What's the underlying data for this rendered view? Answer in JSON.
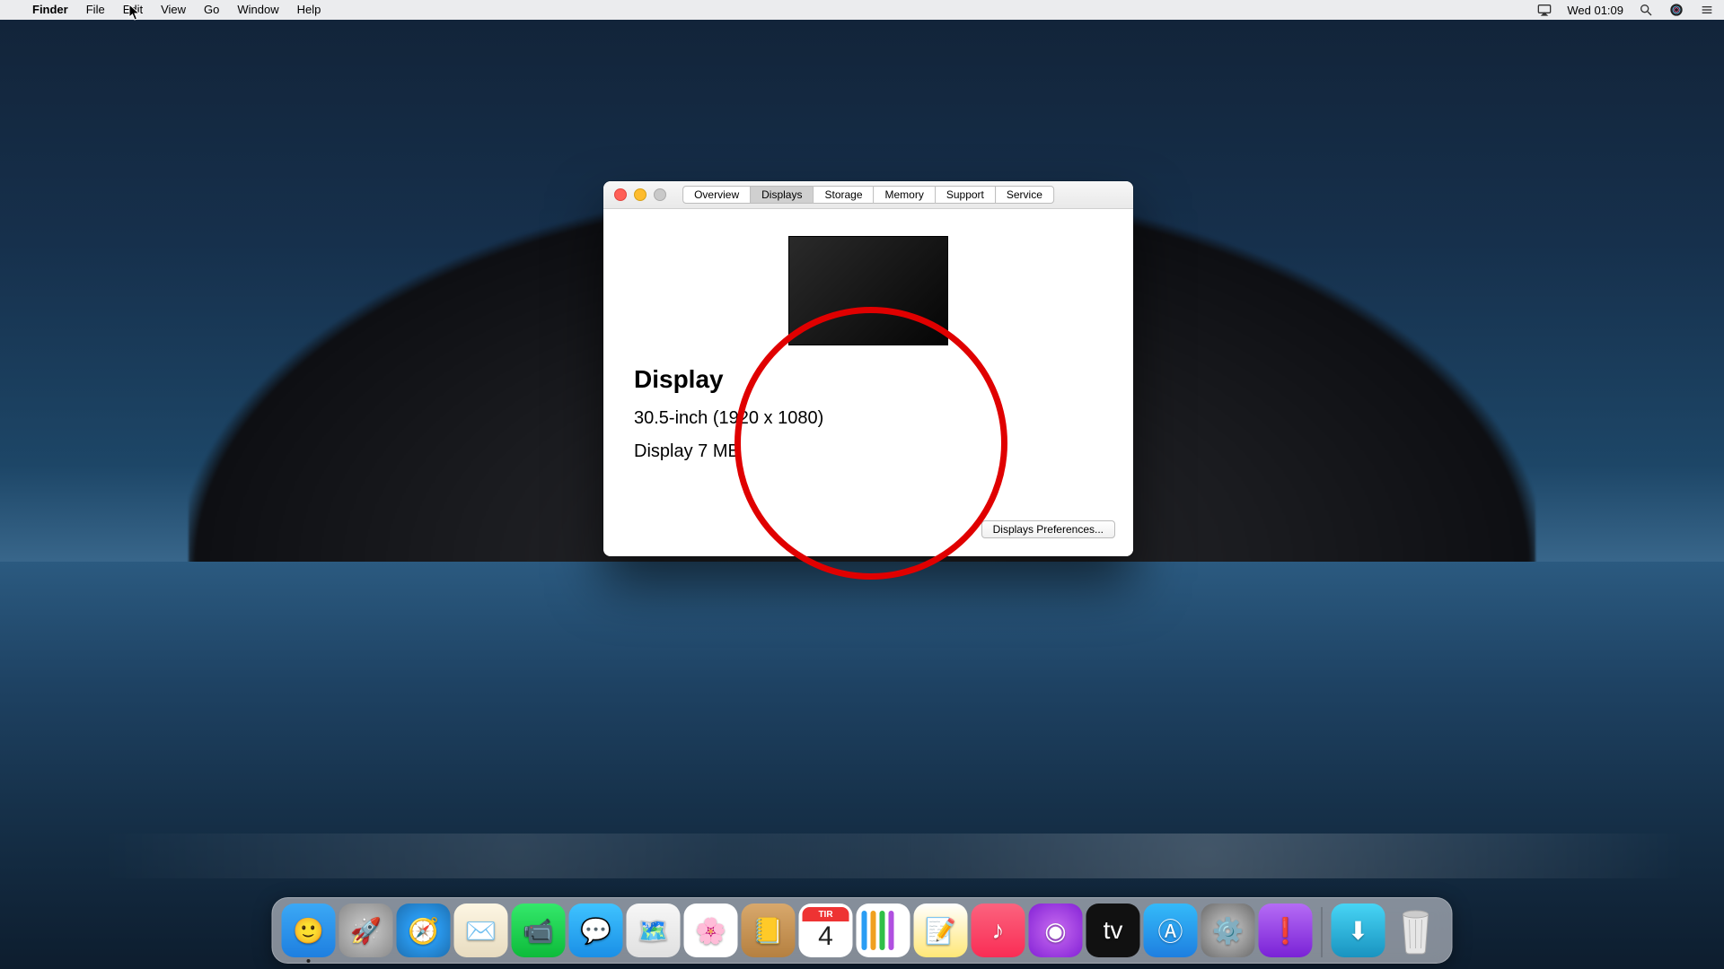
{
  "menubar": {
    "app": "Finder",
    "items": [
      "File",
      "Edit",
      "View",
      "Go",
      "Window",
      "Help"
    ],
    "clock": "Wed 01:09"
  },
  "window": {
    "tabs": [
      "Overview",
      "Displays",
      "Storage",
      "Memory",
      "Support",
      "Service"
    ],
    "active_tab": "Displays",
    "heading": "Display",
    "spec": "30.5-inch (1920 x 1080)",
    "memory": "Display 7 MB",
    "prefs_button": "Displays Preferences..."
  },
  "calendar": {
    "weekday": "TIR",
    "day": "4"
  },
  "annotation": {
    "color": "#e00000"
  }
}
